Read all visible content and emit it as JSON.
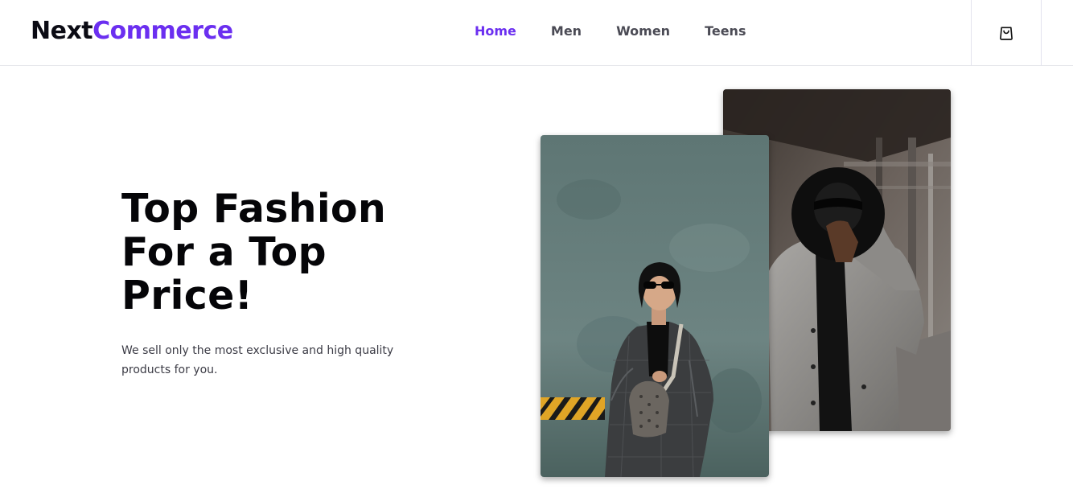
{
  "brand": {
    "part1": "Next",
    "part2": "Commerce"
  },
  "nav": {
    "items": [
      {
        "label": "Home",
        "active": true
      },
      {
        "label": "Men",
        "active": false
      },
      {
        "label": "Women",
        "active": false
      },
      {
        "label": "Teens",
        "active": false
      }
    ]
  },
  "cart": {
    "icon": "shopping-bag-icon"
  },
  "hero": {
    "title_line1": "Top Fashion",
    "title_line2": "For a Top",
    "title_line3": "Price!",
    "subtitle": "We sell only the most exclusive and high quality products for you."
  },
  "images": {
    "back": "man-in-grey-coat-holding-black-hat-photo",
    "front": "woman-in-plaid-coat-with-sunglasses-photo"
  },
  "colors": {
    "accent": "#6b2ff0",
    "text_dark": "#050508",
    "nav_text": "#4b4b55"
  }
}
